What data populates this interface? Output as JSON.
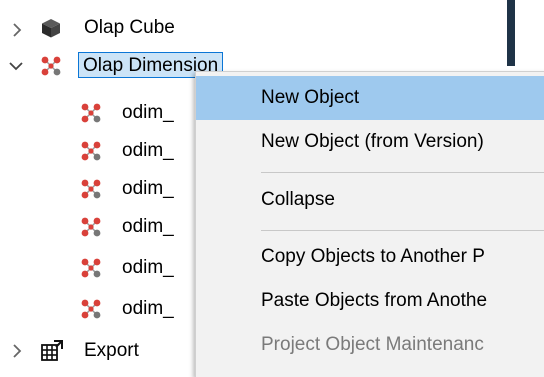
{
  "tree": {
    "items": [
      {
        "label": "Olap Cube",
        "icon": "cube-icon",
        "expander": "collapsed"
      },
      {
        "label": "Olap Dimension",
        "icon": "dimension-icon",
        "expander": "expanded",
        "selected": true
      },
      {
        "label": "odim_"
      },
      {
        "label": "odim_"
      },
      {
        "label": "odim_"
      },
      {
        "label": "odim_"
      },
      {
        "label": "odim_"
      },
      {
        "label": "odim_"
      },
      {
        "label": "Export",
        "icon": "export-icon",
        "expander": "collapsed"
      }
    ]
  },
  "context_menu": {
    "items": [
      {
        "label": "New Object",
        "highlighted": true,
        "enabled": true
      },
      {
        "label": "New Object (from Version)",
        "enabled": true
      },
      {
        "label": "Collapse",
        "enabled": true
      },
      {
        "label": "Copy Objects to Another P",
        "enabled": true
      },
      {
        "label": "Paste Objects from Anothe",
        "enabled": true
      },
      {
        "label": "Project Object Maintenanc",
        "enabled": false
      }
    ]
  },
  "colors": {
    "selection_bg": "#cce4f7",
    "selection_border": "#0b76d6",
    "menu_bg": "#f2f2f2",
    "menu_highlight": "#9ec9ee",
    "disabled_text": "#7a7a7a",
    "dimension_red": "#d9413a"
  }
}
